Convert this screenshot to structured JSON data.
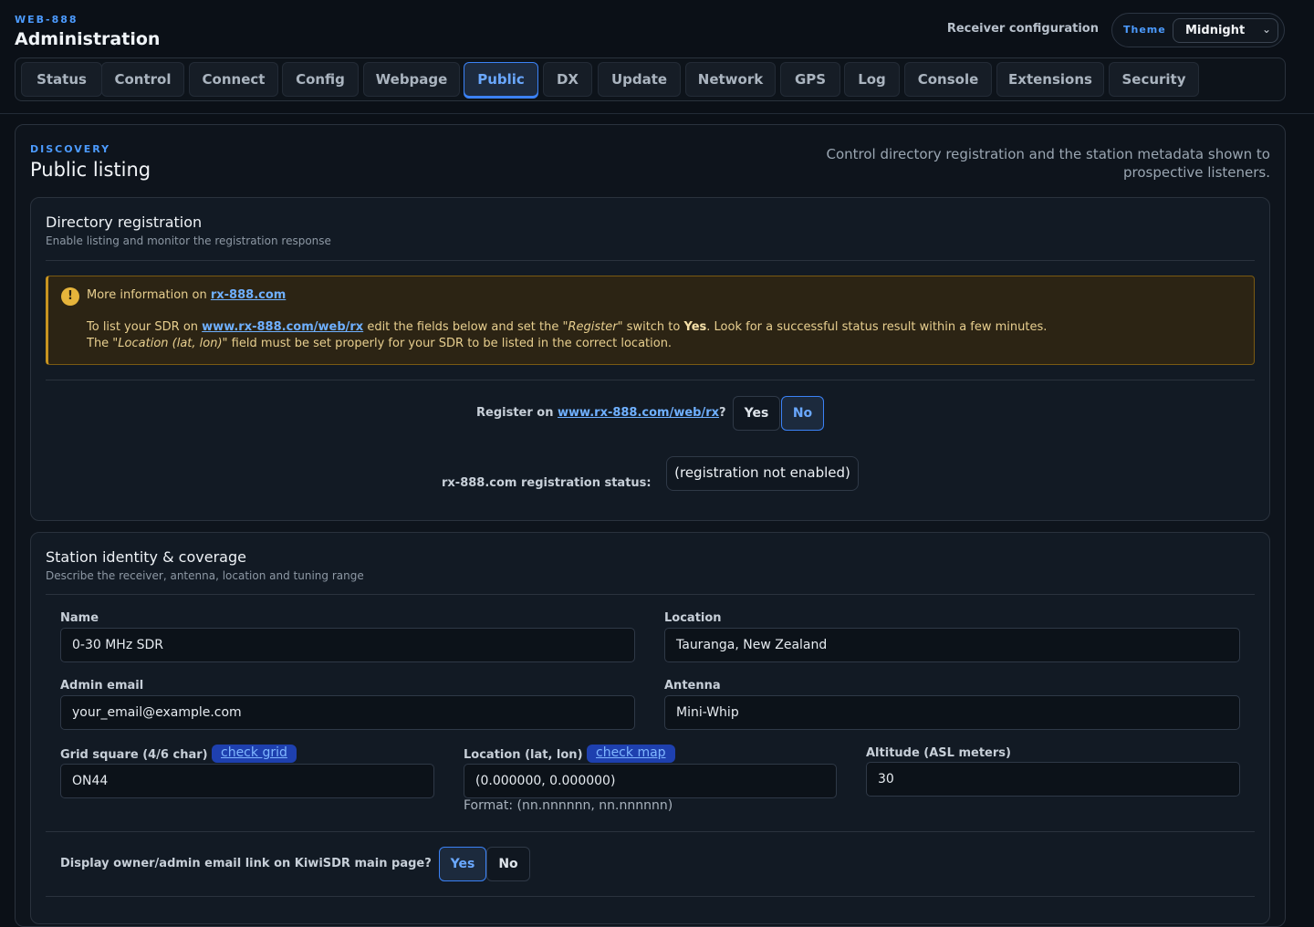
{
  "app": {
    "kicker": "WEB-888",
    "title": "Administration",
    "receiver_config": "Receiver configuration"
  },
  "theme": {
    "label": "Theme",
    "value": "Midnight"
  },
  "tabs": [
    {
      "label": "Status"
    },
    {
      "label": "Control"
    },
    {
      "label": "Connect"
    },
    {
      "label": "Config"
    },
    {
      "label": "Webpage"
    },
    {
      "label": "Public",
      "active": true
    },
    {
      "label": "DX"
    },
    {
      "label": "Update"
    },
    {
      "label": "Network"
    },
    {
      "label": "GPS"
    },
    {
      "label": "Log"
    },
    {
      "label": "Console"
    },
    {
      "label": "Extensions"
    },
    {
      "label": "Security"
    }
  ],
  "page": {
    "kicker": "DISCOVERY",
    "title": "Public listing",
    "description": "Control directory registration and the station metadata shown to prospective listeners."
  },
  "directory": {
    "title": "Directory registration",
    "subtitle": "Enable listing and monitor the registration response",
    "alert": {
      "icon": "!",
      "line1_prefix": "More information on ",
      "line1_link": "rx-888.com",
      "line2_a": "To list your SDR on ",
      "line2_link": "www.rx-888.com/web/rx",
      "line2_b": " edit the fields below and set the \"",
      "line2_em": "Register",
      "line2_c": "\" switch to ",
      "line2_bold": "Yes",
      "line2_d": ". Look for a successful status result within a few minutes.",
      "line3_a": "The \"",
      "line3_em": "Location (lat, lon)",
      "line3_b": "\" field must be set properly for your SDR to be listed in the correct location."
    },
    "register_prefix": "Register on ",
    "register_link": "www.rx-888.com/web/rx",
    "register_suffix": "?",
    "register_yes": "Yes",
    "register_no": "No",
    "register_value": "No",
    "status_label": "rx-888.com registration status:",
    "status_value": "(registration not enabled)"
  },
  "station": {
    "title": "Station identity & coverage",
    "subtitle": "Describe the receiver, antenna, location and tuning range",
    "name_label": "Name",
    "name_value": "0-30 MHz SDR",
    "location_label": "Location",
    "location_value": "Tauranga, New Zealand",
    "email_label": "Admin email",
    "email_value": "your_email@example.com",
    "antenna_label": "Antenna",
    "antenna_value": "Mini-Whip",
    "grid_label": "Grid square (4/6 char)",
    "grid_link": "check grid",
    "grid_value": "ON44",
    "latlon_label": "Location (lat, lon)",
    "latlon_link": "check map",
    "latlon_value": "(0.000000, 0.000000)",
    "latlon_format": "Format: (nn.nnnnnn, nn.nnnnnn)",
    "altitude_label": "Altitude (ASL meters)",
    "altitude_value": "30",
    "display_email_label": "Display owner/admin email link on KiwiSDR main page?",
    "display_email_yes": "Yes",
    "display_email_no": "No",
    "display_email_value": "Yes"
  }
}
